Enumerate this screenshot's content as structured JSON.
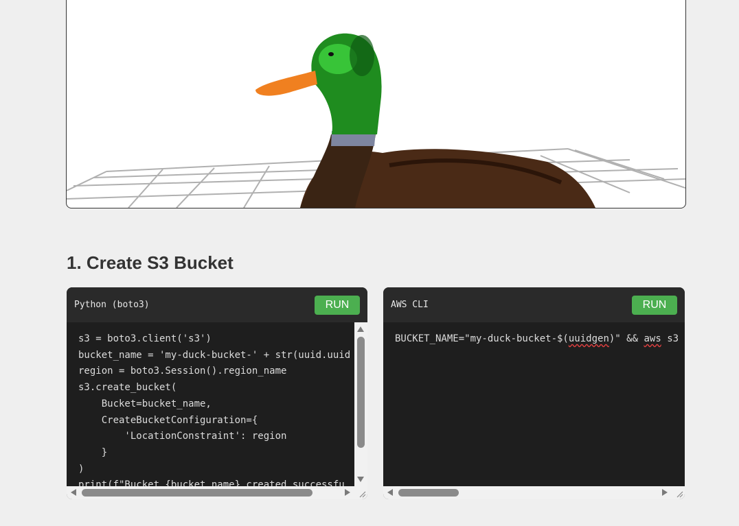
{
  "section": {
    "title": "1. Create S3 Bucket"
  },
  "panels": [
    {
      "language": "Python (boto3)",
      "run_label": "RUN",
      "code_lines": [
        "s3 = boto3.client('s3')",
        "bucket_name = 'my-duck-bucket-' + str(uuid.uuid",
        "region = boto3.Session().region_name",
        "s3.create_bucket(",
        "    Bucket=bucket_name,",
        "    CreateBucketConfiguration={",
        "        'LocationConstraint': region",
        "    }",
        ")",
        "print(f\"Bucket {bucket_name} created successfu"
      ]
    },
    {
      "language": "AWS CLI",
      "run_label": "RUN",
      "code_parts": [
        "BUCKET_NAME=\"my-duck-bucket-$(",
        "uuidgen",
        ")\" && ",
        "aws",
        " s3"
      ]
    }
  ],
  "colors": {
    "run_button": "#4caf50",
    "panel_bg": "#1e1e1e",
    "header_bg": "#2a2a2a"
  }
}
